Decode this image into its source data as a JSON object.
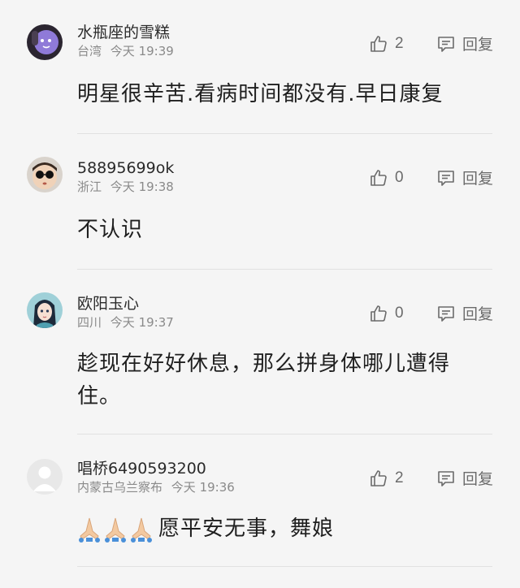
{
  "comments": [
    {
      "username": "水瓶座的雪糕",
      "location": "台湾",
      "time": "今天 19:39",
      "likes": "2",
      "reply_label": "回复",
      "content": "明星很辛苦.看病时间都没有.早日康复",
      "avatar": "purple-cartoon-avatar"
    },
    {
      "username": "58895699ok",
      "location": "浙江",
      "time": "今天 19:38",
      "likes": "0",
      "reply_label": "回复",
      "content": "不认识",
      "avatar": "sunglasses-child-avatar"
    },
    {
      "username": "欧阳玉心",
      "location": "四川",
      "time": "今天 19:37",
      "likes": "0",
      "reply_label": "回复",
      "content": "趁现在好好休息，那么拼身体哪儿遭得住。",
      "avatar": "anime-girl-avatar"
    },
    {
      "username": "唱桥6490593200",
      "location": "内蒙古乌兰察布",
      "time": "今天 19:36",
      "likes": "2",
      "reply_label": "回复",
      "content": "愿平安无事，舞娘",
      "content_emoji": "praying-hands-icon",
      "avatar": "default-avatar"
    }
  ],
  "colors": {
    "background": "#f5f5f5",
    "text_primary": "#1f1f1f",
    "text_secondary": "#8a8a8a",
    "divider": "#e1e1e1",
    "action_gray": "#6b6b6b"
  }
}
